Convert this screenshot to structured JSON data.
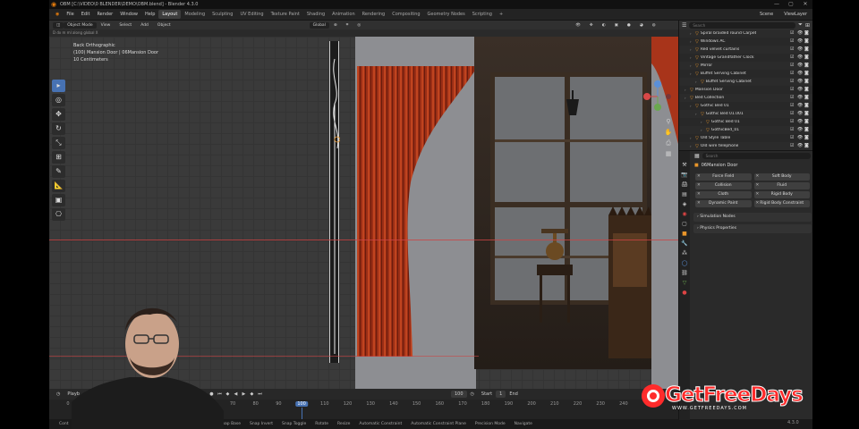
{
  "window": {
    "title": "OBM [C:\\VIDEO\\0 BLENDER\\DEMO\\OBM.blend] - Blender 4.3.0",
    "minimize": "—",
    "maximize": "▢",
    "close": "✕"
  },
  "menu": {
    "items": [
      "File",
      "Edit",
      "Render",
      "Window",
      "Help"
    ],
    "workspaces": [
      "Layout",
      "Modeling",
      "Sculpting",
      "UV Editing",
      "Texture Paint",
      "Shading",
      "Animation",
      "Rendering",
      "Compositing",
      "Geometry Nodes",
      "Scripting"
    ],
    "active_workspace": "Layout",
    "add_tab": "+",
    "scene": "Scene",
    "view_layer": "ViewLayer"
  },
  "viewport_header": {
    "mode": "Object Mode",
    "menus": [
      "View",
      "Select",
      "Add",
      "Object"
    ],
    "orientation": "Global",
    "subheader": "D  dx m  ml along global X"
  },
  "viewport_info": {
    "view": "Back Orthographic",
    "collection": "(100) Mansion Door | 06Mansion Door",
    "scale": "10 Centimeters"
  },
  "timeline": {
    "playback": "Playb",
    "current_frame": "100",
    "start_label": "Start",
    "start_value": "1",
    "end_label": "End",
    "ticks": [
      "0",
      "70",
      "80",
      "90",
      "100",
      "110",
      "120",
      "130",
      "140",
      "150",
      "160",
      "170",
      "180",
      "190",
      "200",
      "210",
      "220",
      "230",
      "240"
    ],
    "current_tick": "100"
  },
  "statusbar": {
    "items": [
      "Cont",
      "Set Snap Base",
      "Snap Invert",
      "Snap Toggle",
      "Rotate",
      "Resize",
      "Automatic Constraint",
      "Automatic Constraint Plane",
      "Precision Mode",
      "Navigate"
    ],
    "version": "4.3.0"
  },
  "outliner": {
    "search_placeholder": "Search",
    "rows": [
      {
        "label": "Spiral braided round Carpet",
        "indent": 2
      },
      {
        "label": "Windows AC",
        "indent": 2
      },
      {
        "label": "Red velvet curtains",
        "indent": 2
      },
      {
        "label": "Vintage Grandfather Clock",
        "indent": 2
      },
      {
        "label": "Mirror",
        "indent": 2
      },
      {
        "label": "Buffet Serving Cabinet",
        "indent": 2
      },
      {
        "label": "Buffet Serving Cabinet",
        "indent": 3
      },
      {
        "label": "Mansion Door",
        "indent": 1
      },
      {
        "label": "Bed Collection",
        "indent": 1
      },
      {
        "label": "Gothic Bed 01",
        "indent": 2
      },
      {
        "label": "Gothic Bed 01.001",
        "indent": 3
      },
      {
        "label": "Gothic Bed 01",
        "indent": 4
      },
      {
        "label": "GothicBed_01",
        "indent": 4
      },
      {
        "label": "Old Style Table",
        "indent": 2
      },
      {
        "label": "Old wire telephone",
        "indent": 2
      }
    ]
  },
  "properties": {
    "search_placeholder": "Search",
    "object_name": "06Mansion Door",
    "physics_buttons": [
      "Force Field",
      "Soft Body",
      "Collision",
      "Fluid",
      "Cloth",
      "Rigid Body",
      "Dynamic Paint",
      "Rigid Body Constraint"
    ],
    "panels": [
      "Simulation Nodes",
      "Physics Properties"
    ]
  },
  "watermark": {
    "main": "GetFreeDays",
    "sub": "WWW.GETFREEDAYS.COM"
  },
  "colors": {
    "accent": "#4772b3",
    "orange": "#e8952a",
    "curtain": "#a8341a",
    "watermark": "#ff2b2b"
  }
}
